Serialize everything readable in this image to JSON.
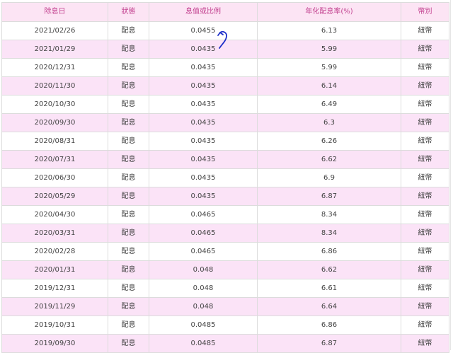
{
  "headers": {
    "date": "除息日",
    "status": "狀態",
    "value": "息值或比例",
    "yield": "年化配息率(%)",
    "currency": "幣別"
  },
  "rows": [
    {
      "date": "2021/02/26",
      "status": "配息",
      "value": "0.0455",
      "yield": "6.13",
      "currency": "紐幣"
    },
    {
      "date": "2021/01/29",
      "status": "配息",
      "value": "0.0435",
      "yield": "5.99",
      "currency": "紐幣"
    },
    {
      "date": "2020/12/31",
      "status": "配息",
      "value": "0.0435",
      "yield": "5.99",
      "currency": "紐幣"
    },
    {
      "date": "2020/11/30",
      "status": "配息",
      "value": "0.0435",
      "yield": "6.14",
      "currency": "紐幣"
    },
    {
      "date": "2020/10/30",
      "status": "配息",
      "value": "0.0435",
      "yield": "6.49",
      "currency": "紐幣"
    },
    {
      "date": "2020/09/30",
      "status": "配息",
      "value": "0.0435",
      "yield": "6.3",
      "currency": "紐幣"
    },
    {
      "date": "2020/08/31",
      "status": "配息",
      "value": "0.0435",
      "yield": "6.26",
      "currency": "紐幣"
    },
    {
      "date": "2020/07/31",
      "status": "配息",
      "value": "0.0435",
      "yield": "6.62",
      "currency": "紐幣"
    },
    {
      "date": "2020/06/30",
      "status": "配息",
      "value": "0.0435",
      "yield": "6.9",
      "currency": "紐幣"
    },
    {
      "date": "2020/05/29",
      "status": "配息",
      "value": "0.0435",
      "yield": "6.87",
      "currency": "紐幣"
    },
    {
      "date": "2020/04/30",
      "status": "配息",
      "value": "0.0465",
      "yield": "8.34",
      "currency": "紐幣"
    },
    {
      "date": "2020/03/31",
      "status": "配息",
      "value": "0.0465",
      "yield": "8.34",
      "currency": "紐幣"
    },
    {
      "date": "2020/02/28",
      "status": "配息",
      "value": "0.0465",
      "yield": "6.86",
      "currency": "紐幣"
    },
    {
      "date": "2020/01/31",
      "status": "配息",
      "value": "0.048",
      "yield": "6.62",
      "currency": "紐幣"
    },
    {
      "date": "2019/12/31",
      "status": "配息",
      "value": "0.048",
      "yield": "6.61",
      "currency": "紐幣"
    },
    {
      "date": "2019/11/29",
      "status": "配息",
      "value": "0.048",
      "yield": "6.64",
      "currency": "紐幣"
    },
    {
      "date": "2019/10/31",
      "status": "配息",
      "value": "0.0485",
      "yield": "6.86",
      "currency": "紐幣"
    },
    {
      "date": "2019/09/30",
      "status": "配息",
      "value": "0.0485",
      "yield": "6.87",
      "currency": "紐幣"
    }
  ],
  "annotation_color": "#1d2fc9",
  "colors": {
    "header_bg": "#fce4f4",
    "header_text": "#c2418f",
    "stripe_bg": "#fbe3f7",
    "border": "#dcdcdc"
  }
}
